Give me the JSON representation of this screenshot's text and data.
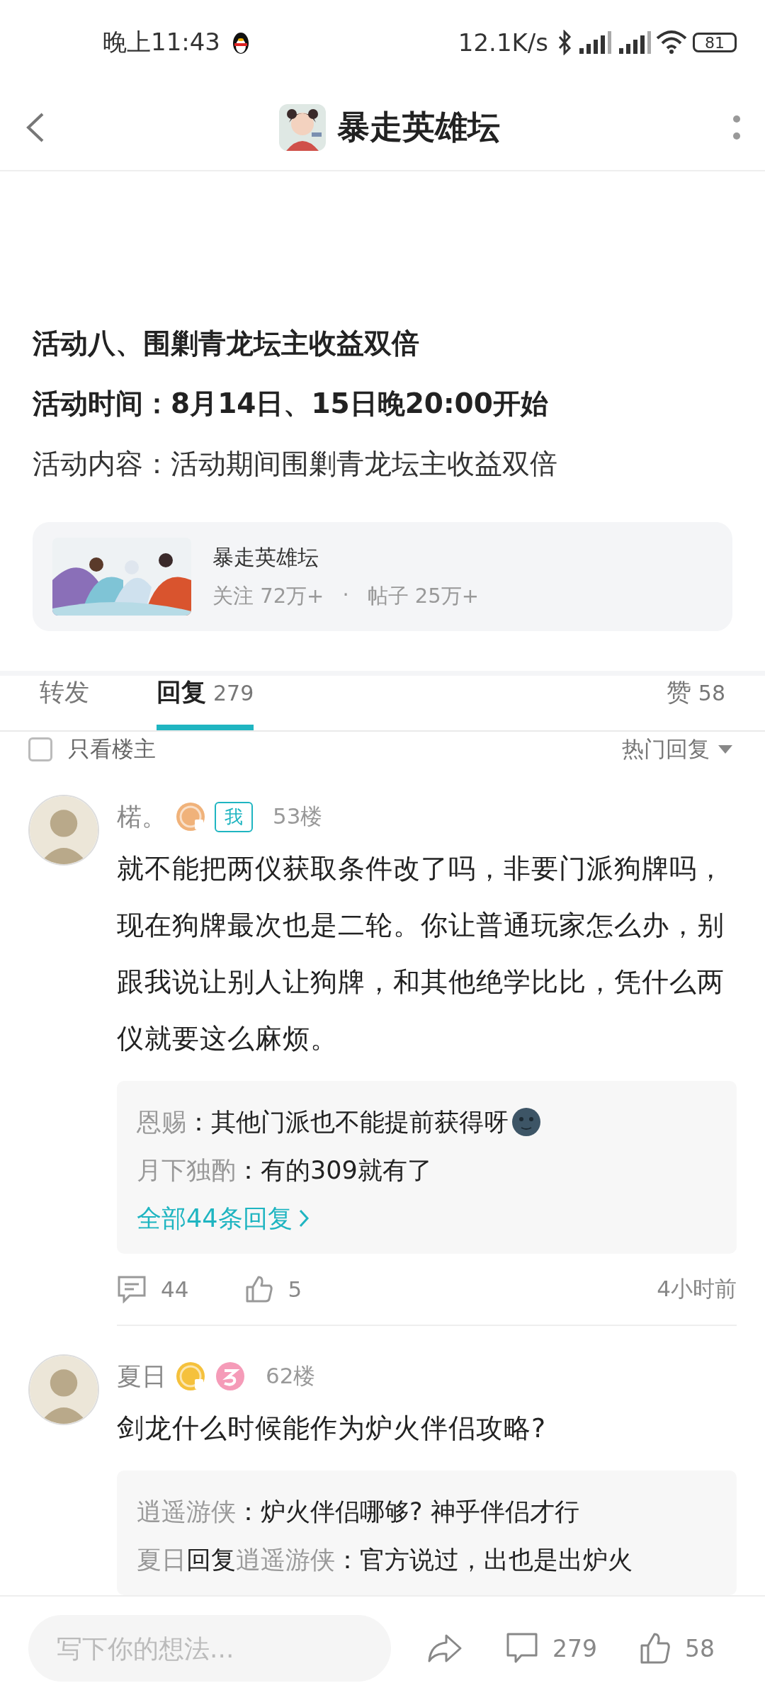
{
  "status_bar": {
    "time": "晚上11:43",
    "speed": "12.1K/s",
    "battery": "81"
  },
  "header": {
    "title": "暴走英雄坛"
  },
  "post": {
    "paragraphs": [
      {
        "text": "活动八、围剿青龙坛主收益双倍",
        "bold": true
      },
      {
        "text": "活动时间：8月14日、15日晚20:00开始",
        "bold": true
      },
      {
        "text": "活动内容：活动期间围剿青龙坛主收益双倍",
        "bold": false
      }
    ]
  },
  "forum_card": {
    "name": "暴走英雄坛",
    "followers": "关注 72万+",
    "separator": "·",
    "posts": "帖子 25万+"
  },
  "tabs": [
    {
      "label": "转发",
      "selected": false
    },
    {
      "label": "回复",
      "count": "279",
      "selected": true
    },
    {
      "label": "赞",
      "count": "58",
      "selected": false
    }
  ],
  "filter": {
    "label": "只看楼主",
    "checked": false,
    "sort": "热门回复"
  },
  "comments": [
    {
      "author": "楉。",
      "badges": [
        {
          "kind": "level",
          "color": "#f0b27a"
        },
        {
          "kind": "me",
          "label": "我"
        }
      ],
      "floor": "53楼",
      "text": "就不能把两仪获取条件改了吗，非要门派狗牌吗，现在狗牌最次也是二轮。你让普通玩家怎么办，别跟我说让别人让狗牌，和其他绝学比比，凭什么两仪就要这么麻烦。",
      "replies": [
        {
          "kind": "plain",
          "author": "恩赐",
          "text": "：其他门派也不能提前获得呀",
          "emoji": true
        },
        {
          "kind": "plain",
          "author": "月下独酌",
          "text": "：有的309就有了",
          "emoji": false
        }
      ],
      "more": "全部44条回复",
      "reply_count": "44",
      "likes": "5",
      "time": "4小时前"
    },
    {
      "author": "夏日",
      "badges": [
        {
          "kind": "level",
          "color": "#f5c13c"
        },
        {
          "kind": "swirl"
        }
      ],
      "floor": "62楼",
      "text": "剑龙什么时候能作为炉火伴侣攻略?",
      "replies": [
        {
          "kind": "plain",
          "author": "逍遥游侠",
          "text": "：炉火伴侣哪够? 神乎伴侣才行",
          "emoji": false
        },
        {
          "kind": "reply_to",
          "author": "夏日",
          "verb": "回复",
          "target": "逍遥游侠",
          "text": "：官方说过，出也是出炉火",
          "emoji": false
        }
      ]
    }
  ],
  "bottom_bar": {
    "placeholder": "写下你的想法...",
    "comments": "279",
    "likes": "58"
  }
}
